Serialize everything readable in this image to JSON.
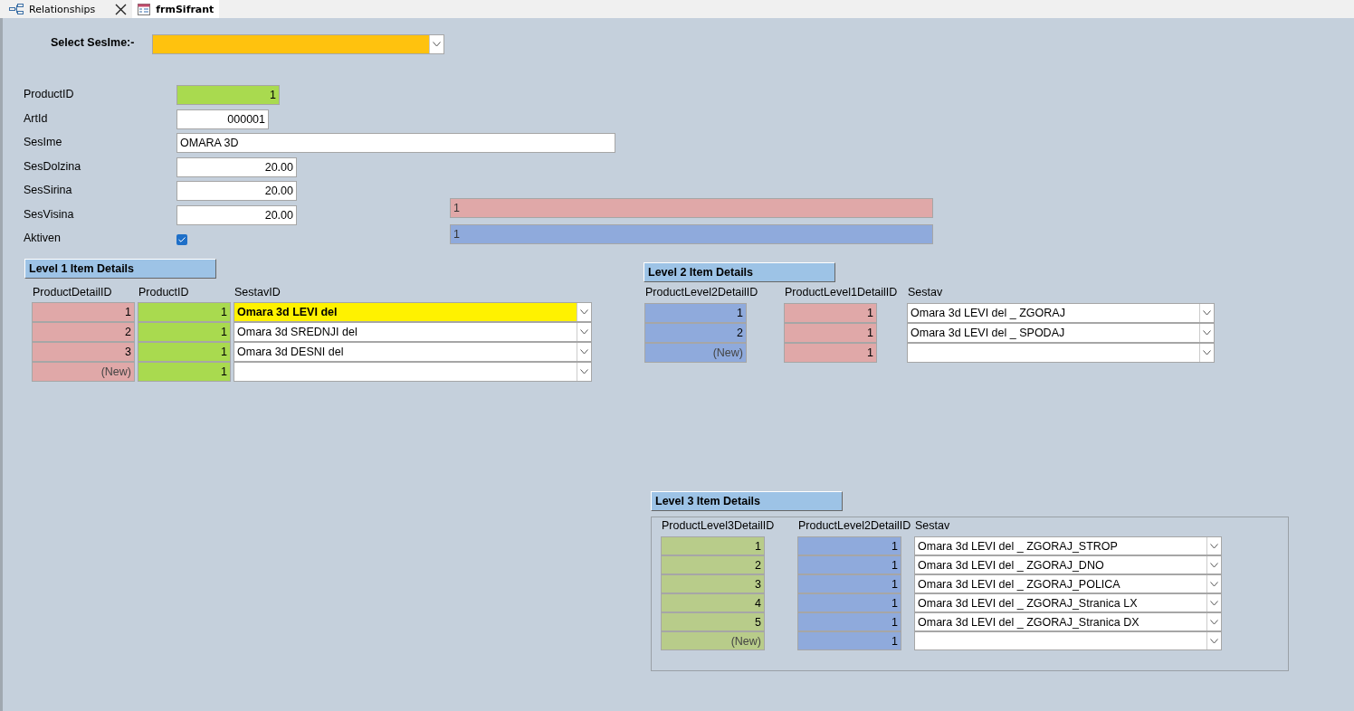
{
  "tabs": [
    {
      "label": "Relationships",
      "selected": false,
      "closable": true
    },
    {
      "label": "frmSifrant",
      "selected": true,
      "closable": false
    }
  ],
  "select": {
    "label": "Select SesIme:-"
  },
  "fields": [
    {
      "label": "ProductID",
      "kind": "number",
      "value": "1",
      "color": "#a9da4f"
    },
    {
      "label": "ArtId",
      "kind": "number",
      "value": "000001",
      "color": "#ffffff"
    },
    {
      "label": "SesIme",
      "kind": "text",
      "value": "OMARA 3D",
      "color": "#ffffff"
    },
    {
      "label": "SesDolzina",
      "kind": "number",
      "value": "20.00",
      "color": "#ffffff"
    },
    {
      "label": "SesSirina",
      "kind": "number",
      "value": "20.00",
      "color": "#ffffff"
    },
    {
      "label": "SesVisina",
      "kind": "number",
      "value": "20.00",
      "color": "#ffffff"
    },
    {
      "label": "Aktiven",
      "kind": "checkbox",
      "checked": true
    }
  ],
  "extra_boxes": [
    {
      "value": "1",
      "color": "#e0a8a8"
    },
    {
      "value": "1",
      "color": "#8faadc"
    }
  ],
  "subforms": [
    {
      "title": "Level 1 Item Details",
      "framed": false,
      "columns": [
        {
          "label": "ProductDetailID",
          "color": "#e0a8a8"
        },
        {
          "label": "ProductID",
          "color": "#a9da4f"
        },
        {
          "label": "SestavID",
          "color": "#ffffff"
        }
      ],
      "rows": [
        {
          "cells": [
            "1",
            "1",
            "Omara 3d LEVI del"
          ],
          "selected": true
        },
        {
          "cells": [
            "2",
            "1",
            "Omara 3d SREDNJI del"
          ],
          "selected": false
        },
        {
          "cells": [
            "3",
            "1",
            "Omara 3d DESNI del"
          ],
          "selected": false
        },
        {
          "cells": [
            "(New)",
            "1",
            ""
          ],
          "selected": false
        }
      ]
    },
    {
      "title": "Level 2 Item Details",
      "framed": false,
      "columns": [
        {
          "label": "ProductLevel2DetailID",
          "color": "#8faadc"
        },
        {
          "label": "ProductLevel1DetailID",
          "color": "#e0a8a8"
        },
        {
          "label": "Sestav",
          "color": "#ffffff"
        }
      ],
      "rows": [
        {
          "cells": [
            "1",
            "1",
            "Omara 3d LEVI del _ ZGORAJ"
          ],
          "selected": false
        },
        {
          "cells": [
            "2",
            "1",
            "Omara 3d LEVI del _ SPODAJ"
          ],
          "selected": false
        },
        {
          "cells": [
            "(New)",
            "1",
            ""
          ],
          "selected": false
        }
      ]
    },
    {
      "title": "Level 3 Item Details",
      "framed": true,
      "columns": [
        {
          "label": "ProductLevel3DetailID",
          "color": "#b8cc8a"
        },
        {
          "label": "ProductLevel2DetailID",
          "color": "#8faadc"
        },
        {
          "label": "Sestav",
          "color": "#ffffff"
        }
      ],
      "rows": [
        {
          "cells": [
            "1",
            "1",
            "Omara 3d LEVI del _ ZGORAJ_STROP"
          ],
          "selected": false
        },
        {
          "cells": [
            "2",
            "1",
            "Omara 3d LEVI del _ ZGORAJ_DNO"
          ],
          "selected": false
        },
        {
          "cells": [
            "3",
            "1",
            "Omara 3d LEVI del _ ZGORAJ_POLICA"
          ],
          "selected": false
        },
        {
          "cells": [
            "4",
            "1",
            "Omara 3d LEVI del _ ZGORAJ_Stranica LX"
          ],
          "selected": false
        },
        {
          "cells": [
            "5",
            "1",
            "Omara 3d LEVI del _ ZGORAJ_Stranica DX"
          ],
          "selected": false
        },
        {
          "cells": [
            "(New)",
            "1",
            ""
          ],
          "selected": false
        }
      ]
    }
  ]
}
